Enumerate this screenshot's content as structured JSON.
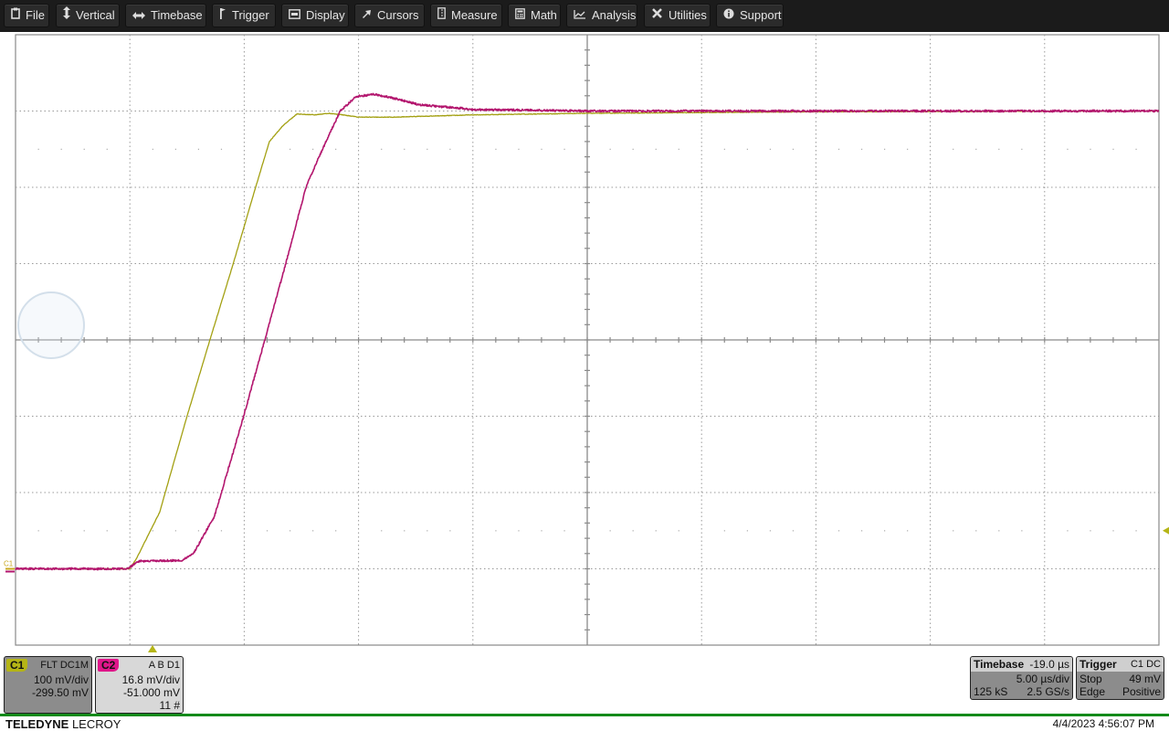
{
  "menubar": {
    "items": [
      {
        "label": "File",
        "icon": "clipboard-icon"
      },
      {
        "label": "Vertical",
        "icon": "vertical-arrows-icon"
      },
      {
        "label": "Timebase",
        "icon": "horizontal-arrows-icon"
      },
      {
        "label": "Trigger",
        "icon": "flag-icon"
      },
      {
        "label": "Display",
        "icon": "display-icon"
      },
      {
        "label": "Cursors",
        "icon": "cursor-arrow-icon"
      },
      {
        "label": "Measure",
        "icon": "ruler-icon"
      },
      {
        "label": "Math",
        "icon": "calculator-icon"
      },
      {
        "label": "Analysis",
        "icon": "analysis-chart-icon"
      },
      {
        "label": "Utilities",
        "icon": "tools-icon"
      },
      {
        "label": "Support",
        "icon": "info-icon"
      }
    ]
  },
  "channels": [
    {
      "name": "C1",
      "mode": "FLT  DC1M",
      "vdiv": "100 mV/div",
      "offset": "-299.50 mV",
      "extra": "",
      "color": "#b5b516"
    },
    {
      "name": "C2",
      "mode": "A  B  D1",
      "vdiv": "16.8 mV/div",
      "offset": "-51.000 mV",
      "extra": "11 #",
      "color": "#e0168a"
    }
  ],
  "timebase": {
    "title": "Timebase",
    "delay": "-19.0 µs",
    "tdiv": "5.00 µs/div",
    "samples": "125 kS",
    "rate": "2.5 GS/s"
  },
  "trigger": {
    "title": "Trigger",
    "source": "C1  DC",
    "mode": "Stop",
    "level": "49 mV",
    "type": "Edge",
    "slope": "Positive"
  },
  "brand": {
    "bold": "TELEDYNE",
    "light": " LECROY"
  },
  "datetime": "4/4/2023 4:56:07 PM",
  "chart_data": {
    "type": "line",
    "title": "",
    "xlabel": "",
    "ylabel": "",
    "grid": true,
    "x_divisions": 10,
    "y_divisions": 8,
    "xlim_div": [
      0,
      10
    ],
    "ylim_div": [
      0,
      8
    ],
    "units_note": "x in divisions from left edge (5.00 µs/div), y in divisions from bottom",
    "trigger_x_div": 1.2,
    "trigger_level_div": 1.5,
    "channel_marker_label": "C1",
    "series": [
      {
        "name": "C1",
        "color": "#a3a012",
        "points": [
          [
            0,
            1.0
          ],
          [
            1.0,
            1.0
          ],
          [
            1.06,
            1.14
          ],
          [
            1.26,
            1.74
          ],
          [
            1.5,
            3.0
          ],
          [
            1.7,
            4.0
          ],
          [
            1.9,
            4.98
          ],
          [
            2.1,
            6.0
          ],
          [
            2.22,
            6.6
          ],
          [
            2.34,
            6.81
          ],
          [
            2.46,
            6.96
          ],
          [
            2.62,
            6.95
          ],
          [
            2.74,
            6.97
          ],
          [
            2.86,
            6.95
          ],
          [
            3.0,
            6.92
          ],
          [
            3.3,
            6.92
          ],
          [
            4.02,
            6.95
          ],
          [
            5.0,
            6.97
          ],
          [
            7.0,
            6.99
          ],
          [
            10.0,
            7.0
          ]
        ]
      },
      {
        "name": "C2",
        "color": "#b3166e",
        "points": [
          [
            0,
            1.0
          ],
          [
            0.98,
            1.0
          ],
          [
            1.08,
            1.1
          ],
          [
            1.46,
            1.11
          ],
          [
            1.56,
            1.21
          ],
          [
            1.74,
            1.69
          ],
          [
            1.98,
            2.92
          ],
          [
            2.18,
            4.0
          ],
          [
            2.36,
            4.98
          ],
          [
            2.54,
            6.0
          ],
          [
            2.66,
            6.42
          ],
          [
            2.84,
            7.0
          ],
          [
            2.98,
            7.19
          ],
          [
            3.14,
            7.22
          ],
          [
            3.3,
            7.17
          ],
          [
            3.54,
            7.08
          ],
          [
            4.02,
            7.02
          ],
          [
            5.0,
            7.0
          ],
          [
            10.0,
            7.0
          ]
        ]
      }
    ]
  }
}
